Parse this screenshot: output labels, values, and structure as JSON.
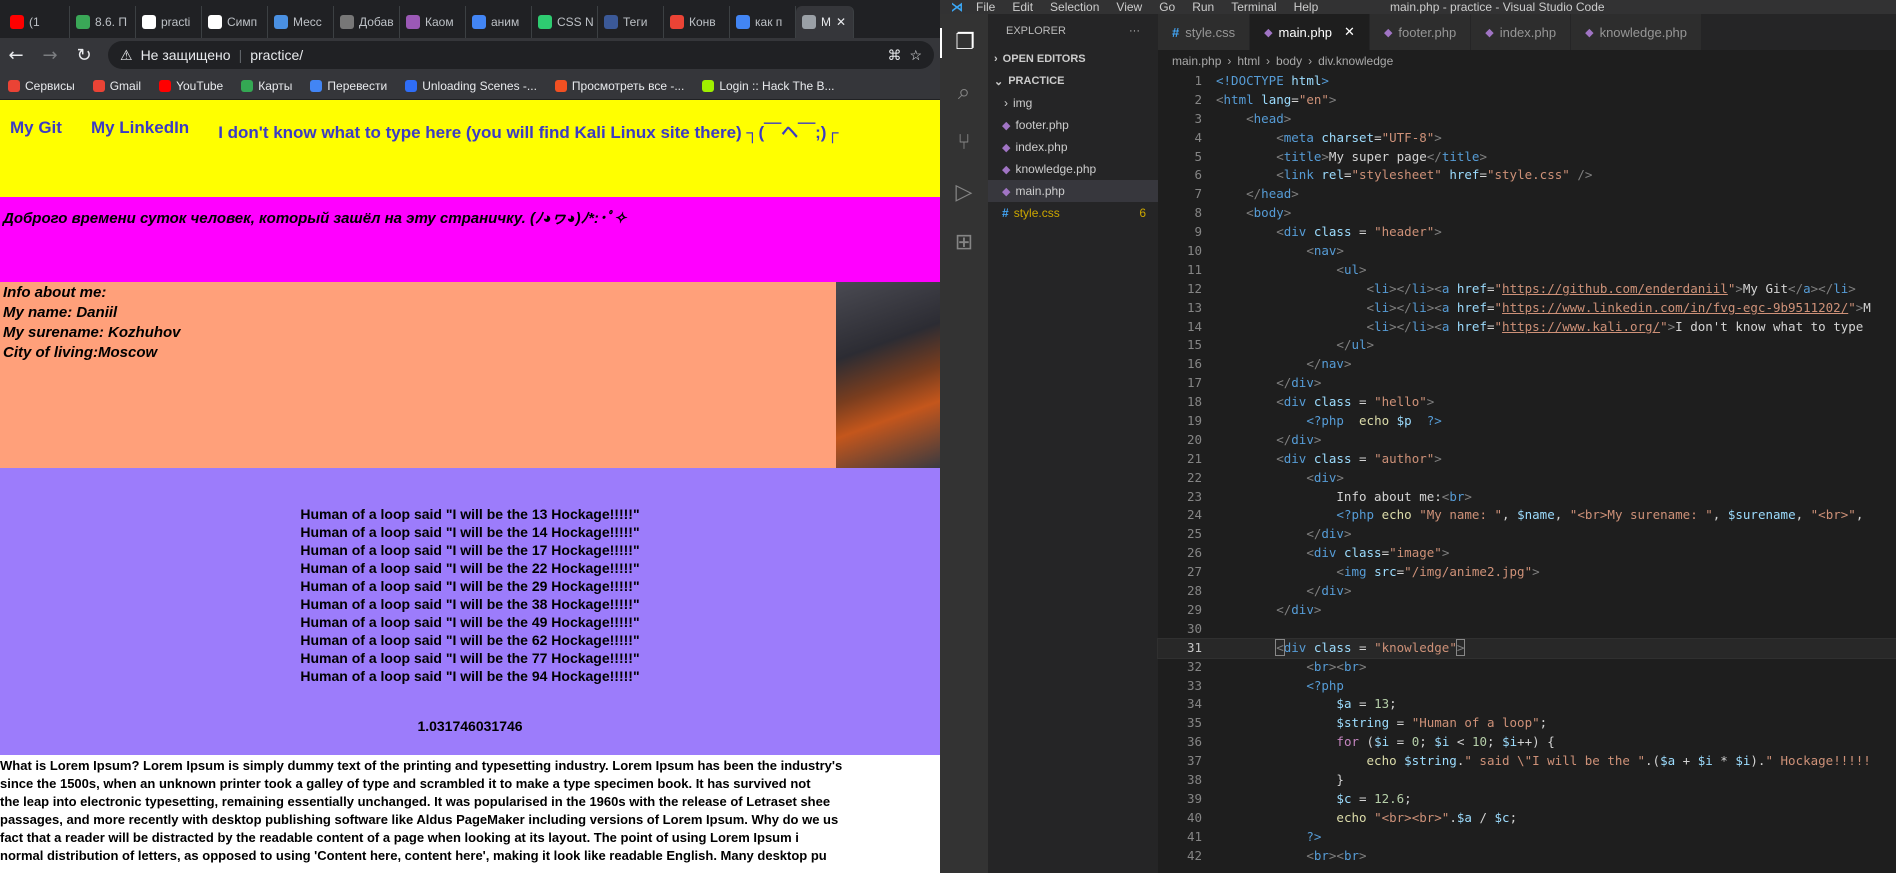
{
  "browser": {
    "tabs": [
      {
        "label": "(1",
        "color": "#ff0000"
      },
      {
        "label": "8.6. П",
        "color": "#3aa757"
      },
      {
        "label": "practi",
        "color": "#ffffff"
      },
      {
        "label": "Симп",
        "color": "#ffffff"
      },
      {
        "label": "Месс",
        "color": "#4a90e2"
      },
      {
        "label": "Добав",
        "color": "#777777"
      },
      {
        "label": "Каом",
        "color": "#9b59b6"
      },
      {
        "label": "аним",
        "color": "#4285f4"
      },
      {
        "label": "CSS N",
        "color": "#2ecc71"
      },
      {
        "label": "Теги",
        "color": "#3b5998"
      },
      {
        "label": "Конв",
        "color": "#ea4335"
      },
      {
        "label": "как п",
        "color": "#4285f4"
      },
      {
        "label": "M",
        "color": "#9aa0a6"
      }
    ],
    "url_warning": "Не защищено",
    "url": "practice/",
    "bookmarks": [
      {
        "label": "Сервисы",
        "color": "#ea4335"
      },
      {
        "label": "Gmail",
        "color": "#ea4335"
      },
      {
        "label": "YouTube",
        "color": "#ff0000"
      },
      {
        "label": "Карты",
        "color": "#34a853"
      },
      {
        "label": "Перевести",
        "color": "#4285f4"
      },
      {
        "label": "Unloading Scenes -...",
        "color": "#2f6df6"
      },
      {
        "label": "Просмотреть все -...",
        "color": "#f25022"
      },
      {
        "label": "Login :: Hack The B...",
        "color": "#9fef00"
      }
    ]
  },
  "page": {
    "nav": [
      "My Git",
      "My LinkedIn",
      "I don't know what to type here (you will find Kali Linux site there) ┐(￣ヘ￣;)┌"
    ],
    "hello": "Доброго времени суток человек, который зашёл на эту страничку. (ﾉ◕ヮ◕)ﾉ*:･ﾟ✧",
    "author": [
      "Info about me:",
      "My name: Daniil",
      "My surename: Kozhuhov",
      "City of living:Moscow"
    ],
    "loop_lines": [
      "Human of a loop said \"I will be the 13 Hockage!!!!!\"",
      "Human of a loop said \"I will be the 14 Hockage!!!!!\"",
      "Human of a loop said \"I will be the 17 Hockage!!!!!\"",
      "Human of a loop said \"I will be the 22 Hockage!!!!!\"",
      "Human of a loop said \"I will be the 29 Hockage!!!!!\"",
      "Human of a loop said \"I will be the 38 Hockage!!!!!\"",
      "Human of a loop said \"I will be the 49 Hockage!!!!!\"",
      "Human of a loop said \"I will be the 62 Hockage!!!!!\"",
      "Human of a loop said \"I will be the 77 Hockage!!!!!\"",
      "Human of a loop said \"I will be the 94 Hockage!!!!!\""
    ],
    "result": "1.031746031746",
    "lorem": [
      "What is Lorem Ipsum? Lorem Ipsum is simply dummy text of the printing and typesetting industry. Lorem Ipsum has been the industry's",
      "since the 1500s, when an unknown printer took a galley of type and scrambled it to make a type specimen book. It has survived not",
      "the leap into electronic typesetting, remaining essentially unchanged. It was popularised in the 1960s with the release of Letraset shee",
      "passages, and more recently with desktop publishing software like Aldus PageMaker including versions of Lorem Ipsum. Why do we us",
      "fact that a reader will be distracted by the readable content of a page when looking at its layout. The point of using Lorem Ipsum i",
      "normal distribution of letters, as opposed to using 'Content here, content here', making it look like readable English. Many desktop pu"
    ]
  },
  "vscode": {
    "menu": [
      "File",
      "Edit",
      "Selection",
      "View",
      "Go",
      "Run",
      "Terminal",
      "Help"
    ],
    "title": "main.php - practice - Visual Studio Code",
    "explorer_title": "EXPLORER",
    "explorer_more": "···",
    "open_editors": "OPEN EDITORS",
    "project": "PRACTICE",
    "files": [
      {
        "name": "img",
        "type": "folder"
      },
      {
        "name": "footer.php",
        "type": "php"
      },
      {
        "name": "index.php",
        "type": "php"
      },
      {
        "name": "knowledge.php",
        "type": "php"
      },
      {
        "name": "main.php",
        "type": "php"
      },
      {
        "name": "style.css",
        "type": "css",
        "badge": "6"
      }
    ],
    "tabs": [
      "style.css",
      "main.php",
      "footer.php",
      "index.php",
      "knowledge.php"
    ],
    "active_tab": "main.php",
    "breadcrumb": [
      "main.php",
      "html",
      "body",
      "div.knowledge"
    ],
    "current_line": "31"
  }
}
